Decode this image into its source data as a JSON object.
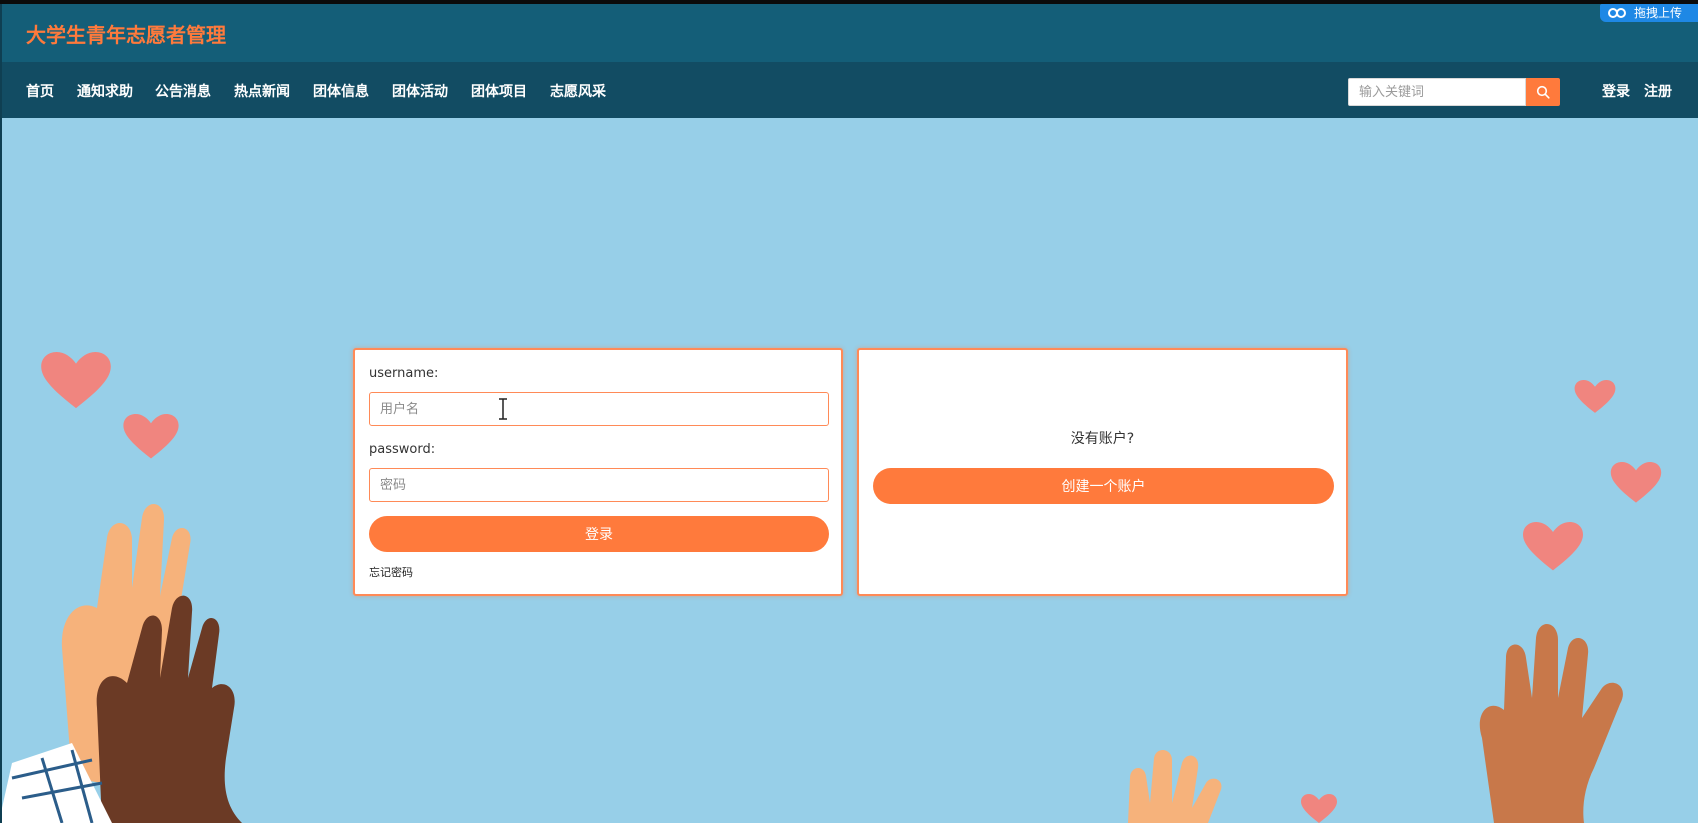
{
  "header": {
    "site_title": "大学生青年志愿者管理",
    "upload_label": "拖拽上传"
  },
  "nav": {
    "items": [
      "首页",
      "通知求助",
      "公告消息",
      "热点新闻",
      "团体信息",
      "团体活动",
      "团体项目",
      "志愿风采"
    ],
    "search_placeholder": "输入关键词",
    "search_icon": "search-icon",
    "login": "登录",
    "register": "注册"
  },
  "login_form": {
    "username_label": "username:",
    "username_placeholder": "用户名",
    "password_label": "password:",
    "password_placeholder": "密码",
    "submit": "登录",
    "forgot": "忘记密码"
  },
  "signup_panel": {
    "prompt": "没有账户?",
    "create_button": "创建一个账户"
  },
  "colors": {
    "header_bg": "#145e78",
    "nav_bg": "#124c63",
    "accent": "#ff7a3c",
    "background": "#97cfe8",
    "title_color": "#ff7a3c"
  }
}
